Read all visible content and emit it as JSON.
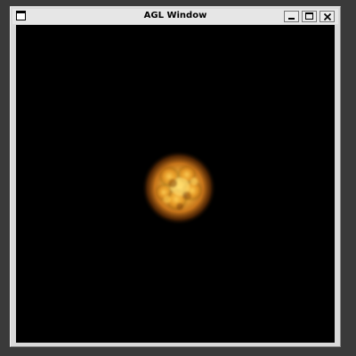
{
  "window": {
    "title": "AGL Window"
  },
  "icons": {
    "window_menu": "window-menu-icon",
    "minimize": "minimize-icon",
    "maximize": "maximize-icon",
    "close": "close-icon",
    "particle": "fire-particle-burst"
  },
  "colors": {
    "desktop": "#3a3a3a",
    "window_frame": "#d9d9d9",
    "titlebar": "#e6e6e6",
    "canvas": "#000000",
    "fire_core": "#ffd35a",
    "fire_mid": "#e59a1c",
    "fire_edge": "#7a3d05"
  }
}
